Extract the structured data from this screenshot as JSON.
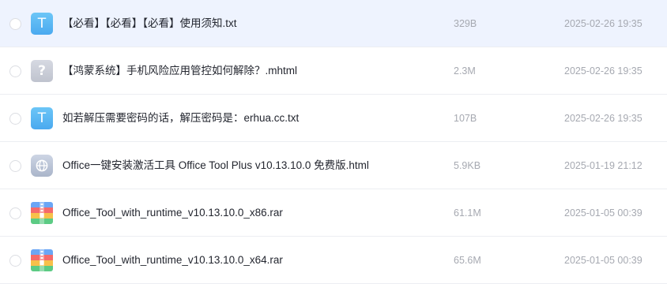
{
  "files": [
    {
      "name": "【必看】【必看】【必看】使用须知.txt",
      "size": "329B",
      "date": "2025-02-26 19:35",
      "icon": "txt-file-icon",
      "icon_glyph": "T",
      "selected": true
    },
    {
      "name": "【鸿蒙系统】手机风险应用管控如何解除？.mhtml",
      "size": "2.3M",
      "date": "2025-02-26 19:35",
      "icon": "unknown-file-icon",
      "icon_glyph": "?",
      "selected": false
    },
    {
      "name": "如若解压需要密码的话，解压密码是：erhua.cc.txt",
      "size": "107B",
      "date": "2025-02-26 19:35",
      "icon": "txt-file-icon",
      "icon_glyph": "T",
      "selected": false
    },
    {
      "name": "Office一键安装激活工具 Office Tool Plus v10.13.10.0 免费版.html",
      "size": "5.9KB",
      "date": "2025-01-19 21:12",
      "icon": "html-file-icon",
      "selected": false
    },
    {
      "name": "Office_Tool_with_runtime_v10.13.10.0_x86.rar",
      "size": "61.1M",
      "date": "2025-01-05 00:39",
      "icon": "rar-archive-icon",
      "selected": false
    },
    {
      "name": "Office_Tool_with_runtime_v10.13.10.0_x64.rar",
      "size": "65.6M",
      "date": "2025-01-05 00:39",
      "icon": "rar-archive-icon",
      "selected": false
    }
  ],
  "colors": {
    "selected_row_bg": "#eef3fe",
    "txt_icon": "#4aa9ef",
    "unknown_icon": "#c6cad4",
    "html_icon": "#b5bfd1",
    "meta_text": "#a6a9b1",
    "name_text": "#23262f"
  }
}
